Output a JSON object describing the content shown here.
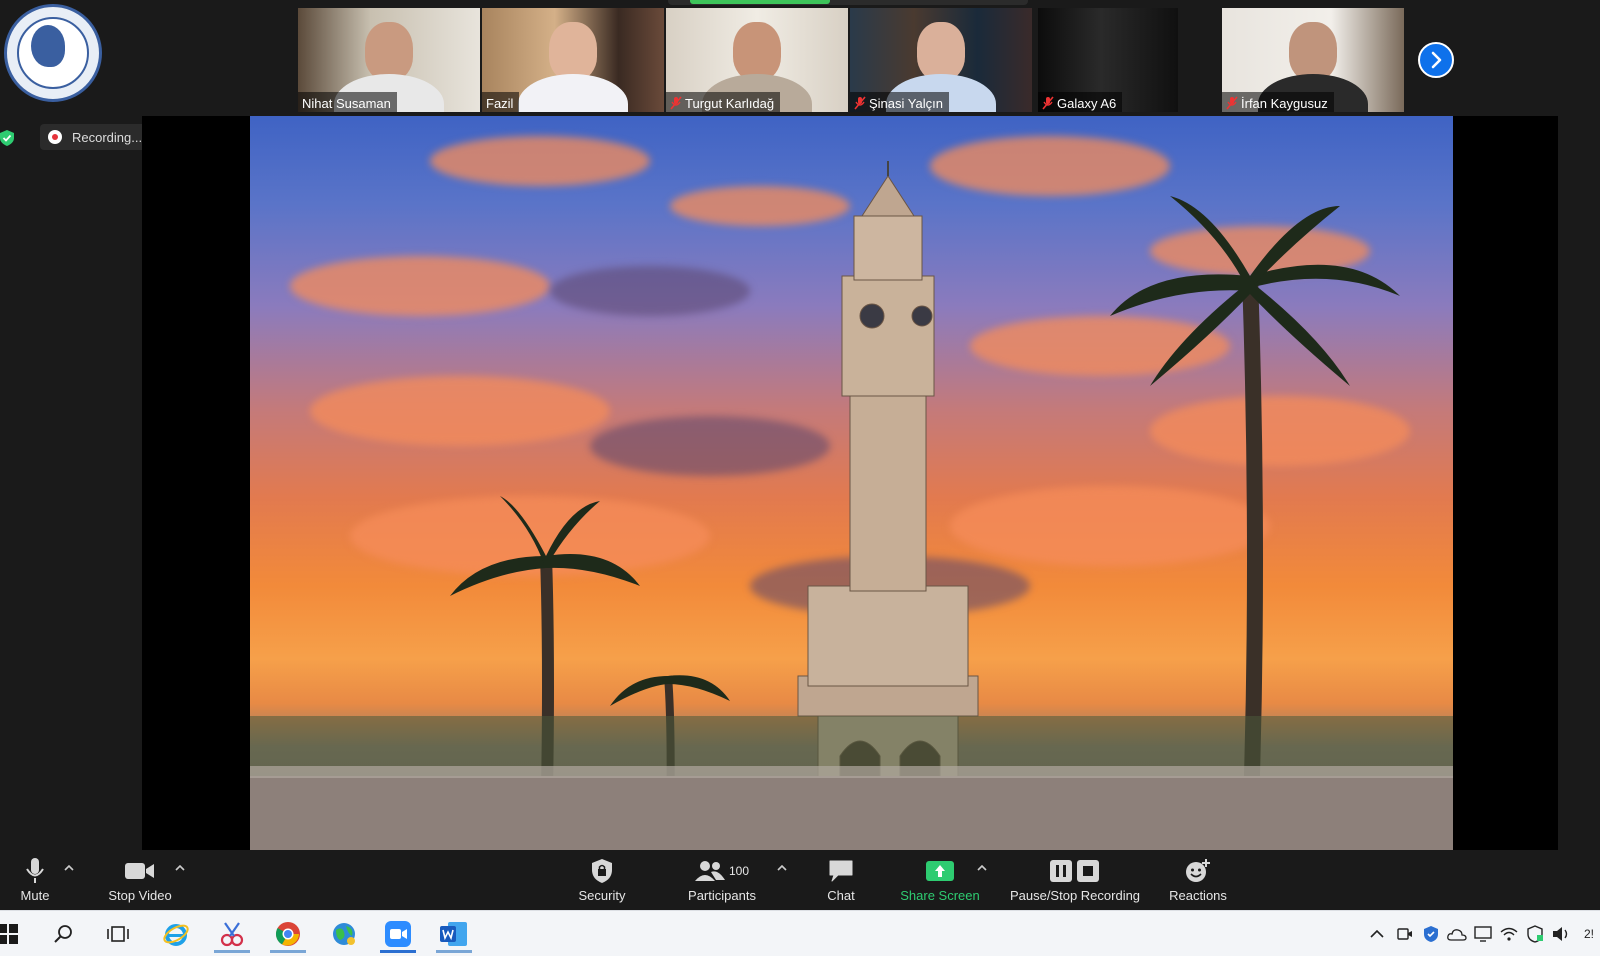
{
  "meeting": {
    "participants_strip": [
      {
        "name": "Nihat Susaman",
        "muted": false,
        "active": false
      },
      {
        "name": "Fazil",
        "muted": false,
        "active": true
      },
      {
        "name": "Turgut Karlıdağ",
        "muted": true,
        "active": false
      },
      {
        "name": "Şinasi Yalçın",
        "muted": true,
        "active": false
      },
      {
        "name": "Galaxy A6",
        "muted": true,
        "active": false
      },
      {
        "name": "İrfan Kaygusuz",
        "muted": true,
        "active": false
      }
    ],
    "recording_label": "Recording...",
    "logo_icon": "society-logo-icon"
  },
  "toolbar": {
    "mute": "Mute",
    "stop_video": "Stop Video",
    "security": "Security",
    "participants": "Participants",
    "participants_count": "100",
    "chat": "Chat",
    "share_screen": "Share Screen",
    "pause_stop_recording": "Pause/Stop Recording",
    "reactions": "Reactions"
  },
  "taskbar": {
    "apps": [
      "start-icon",
      "search-icon",
      "task-view-icon",
      "internet-explorer-icon",
      "snipping-tool-icon",
      "chrome-icon",
      "globe-app-icon",
      "zoom-icon",
      "word-icon"
    ],
    "clock_partial": "2!"
  },
  "colors": {
    "accent_green": "#2ecc71",
    "zoom_blue": "#0e71eb",
    "record_red": "#e5323a",
    "active_speaker": "#b9d43a"
  }
}
